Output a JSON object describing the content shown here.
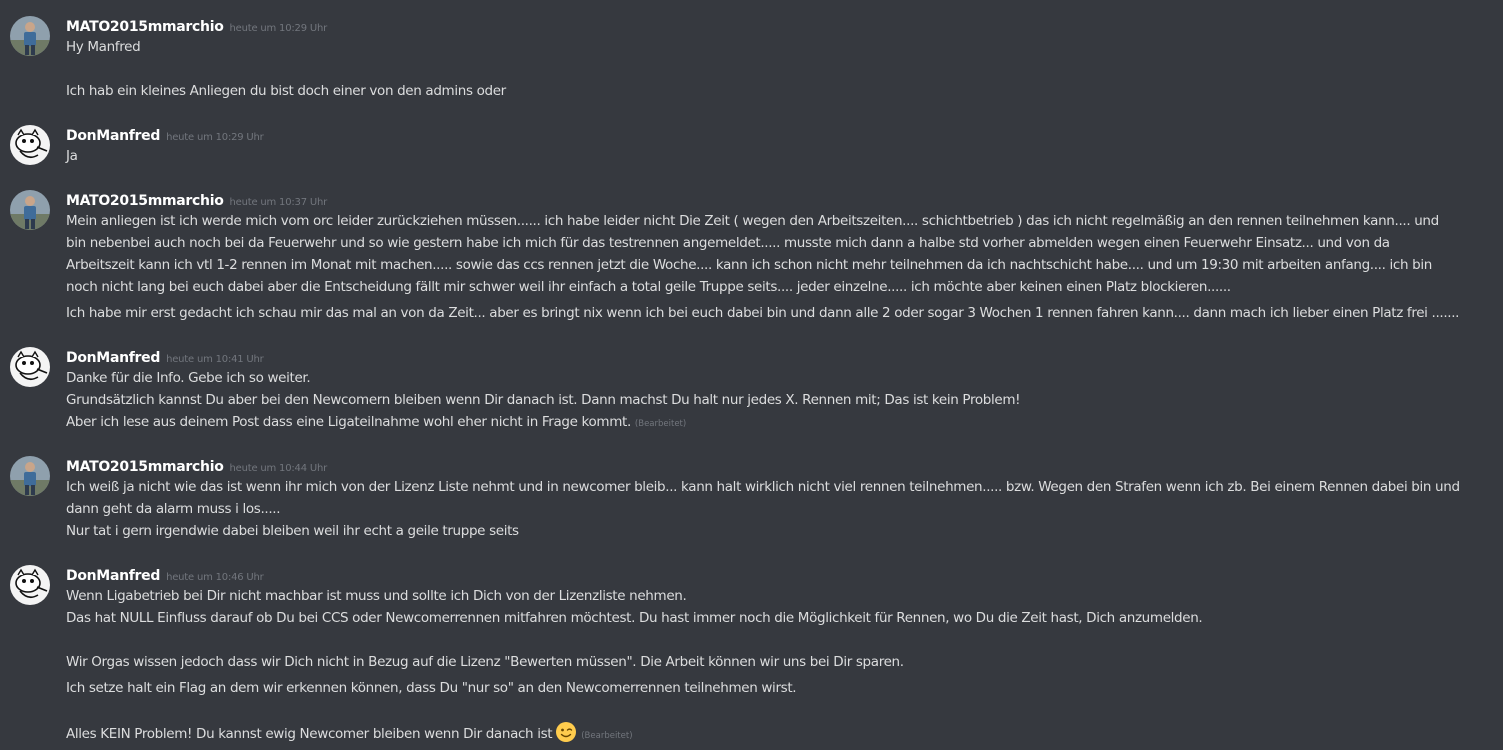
{
  "colors": {
    "background": "#36393f",
    "text": "#dcddde",
    "username": "#ffffff",
    "timestamp": "#72767d"
  },
  "messages": [
    {
      "author": "MATO2015mmarchio",
      "avatar": "photo-avatar",
      "timestamp": "heute um 10:29 Uhr",
      "lines": [
        "Hy Manfred",
        "Ich hab ein kleines Anliegen du bist doch einer von den admins oder"
      ]
    },
    {
      "author": "DonManfred",
      "avatar": "cartoon-cat-avatar",
      "timestamp": "heute um 10:29 Uhr",
      "lines": [
        "Ja"
      ]
    },
    {
      "author": "MATO2015mmarchio",
      "avatar": "photo-avatar",
      "timestamp": "heute um 10:37 Uhr",
      "lines": [
        "Mein anliegen ist ich werde mich vom orc leider zurückziehen  müssen...... ich  habe leider nicht Die Zeit ( wegen den Arbeitszeiten....  schichtbetrieb ) das ich nicht regelmäßig an den rennen teilnehmen kann.... und bin nebenbei auch noch bei da Feuerwehr und so wie gestern habe ich mich für das testrennen angemeldet..... musste mich dann a halbe std vorher abmelden wegen einen Feuerwehr Einsatz... und von da Arbeitszeit kann ich vtl 1-2 rennen im Monat mit machen..... sowie das ccs rennen jetzt die Woche.... kann ich schon nicht mehr teilnehmen da ich nachtschicht habe.... und um 19:30 mit arbeiten anfang.... ich bin noch nicht lang bei euch dabei aber die Entscheidung fällt mir schwer weil ihr einfach a total geile Truppe seits....  jeder einzelne..... ich möchte aber keinen einen Platz blockieren......",
        "Ich habe mir erst gedacht ich schau mir das mal an von da Zeit... aber es bringt nix wenn ich bei euch dabei bin und dann alle 2 oder sogar 3 Wochen 1 rennen fahren kann.... dann mach ich lieber einen Platz frei ......."
      ]
    },
    {
      "author": "DonManfred",
      "avatar": "cartoon-cat-avatar",
      "timestamp": "heute um 10:41 Uhr",
      "lines": [
        "Danke für die Info. Gebe ich so weiter.",
        "Grundsätzlich kannst Du aber bei den Newcomern bleiben wenn Dir danach ist. Dann machst Du halt nur jedes X. Rennen mit; Das ist kein Problem!",
        "Aber ich lese aus deinem Post dass eine Ligateilnahme wohl eher nicht in Frage kommt."
      ],
      "edited": "(Bearbeitet)"
    },
    {
      "author": "MATO2015mmarchio",
      "avatar": "photo-avatar",
      "timestamp": "heute um 10:44 Uhr",
      "lines": [
        "Ich weiß ja nicht wie das ist wenn ihr mich von der Lizenz Liste nehmt und in newcomer bleib...  kann halt wirklich nicht viel rennen teilnehmen..... bzw. Wegen den Strafen wenn ich zb. Bei einem Rennen dabei bin und dann geht da alarm muss i los.....",
        "Nur tat i gern irgendwie dabei bleiben weil ihr echt a geile truppe seits"
      ]
    },
    {
      "author": "DonManfred",
      "avatar": "cartoon-cat-avatar",
      "timestamp": "heute um 10:46 Uhr",
      "lines": [
        "Wenn Ligabetrieb bei Dir nicht machbar ist muss und sollte ich Dich von der Lizenzliste nehmen.",
        "Das hat NULL Einfluss darauf ob Du bei CCS oder Newcomerrennen mitfahren möchtest. Du hast immer noch die Möglichkeit für Rennen, wo Du die Zeit hast, Dich anzumelden.",
        "Wir Orgas wissen jedoch dass wir Dich nicht in Bezug auf die Lizenz \"Bewerten müssen\". Die Arbeit können wir uns bei Dir sparen.",
        "Ich setze halt ein Flag an dem wir erkennen können, dass Du \"nur so\" an den Newcomerrennen teilnehmen wirst.",
        "Alles KEIN Problem! Du kannst ewig Newcomer bleiben wenn Dir danach ist"
      ],
      "emoji": "winking-face-emoji",
      "edited": "(Bearbeitet)"
    }
  ]
}
